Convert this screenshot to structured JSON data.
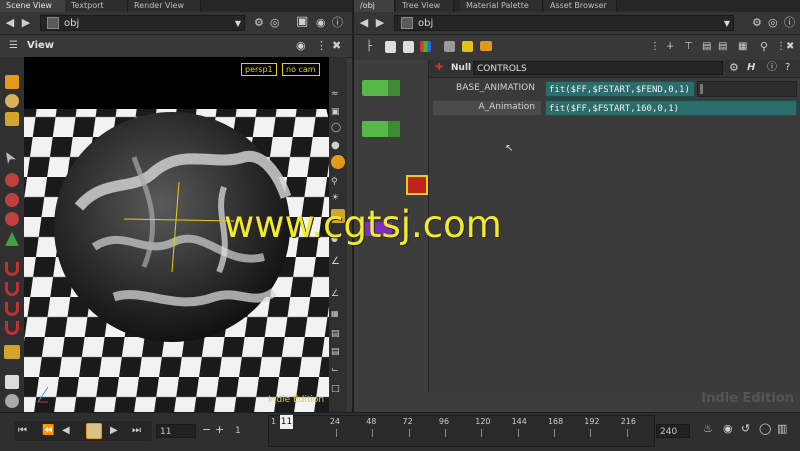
{
  "left_tabs": [
    "Scene View",
    "Textport",
    "Render View"
  ],
  "right_tabs": [
    "/obj",
    "Tree View",
    "Material Palette",
    "Asset Browser"
  ],
  "left_path": "obj",
  "right_path": "obj",
  "viewport": {
    "title": "View",
    "camera_menu": "persp1",
    "cam_menu": "no cam",
    "edition_label": "Indie Edition"
  },
  "network": {
    "edition_watermark": "Indie Edition"
  },
  "params": {
    "node_type": "Null",
    "node_name": "CONTROLS",
    "rows": [
      {
        "label": "BASE_ANIMATION",
        "expr": "fit($FF,$FSTART,$FEND,0,1)"
      },
      {
        "label": "A_Animation",
        "expr": "fit($FF,$FSTART,160,0,1)"
      }
    ]
  },
  "watermark": "www.cgtsj.com",
  "playbar": {
    "current_frame": "11",
    "start_frame": "1",
    "end_frame": "240",
    "ruler_start": "1",
    "ruler_current": "11",
    "ticks": [
      "24",
      "48",
      "72",
      "96",
      "120",
      "144",
      "168",
      "192",
      "216"
    ]
  },
  "colors": {
    "expr_bg": "#2b6d6a",
    "accent_orange": "#e39a1b",
    "node_green": "#57b84a"
  }
}
